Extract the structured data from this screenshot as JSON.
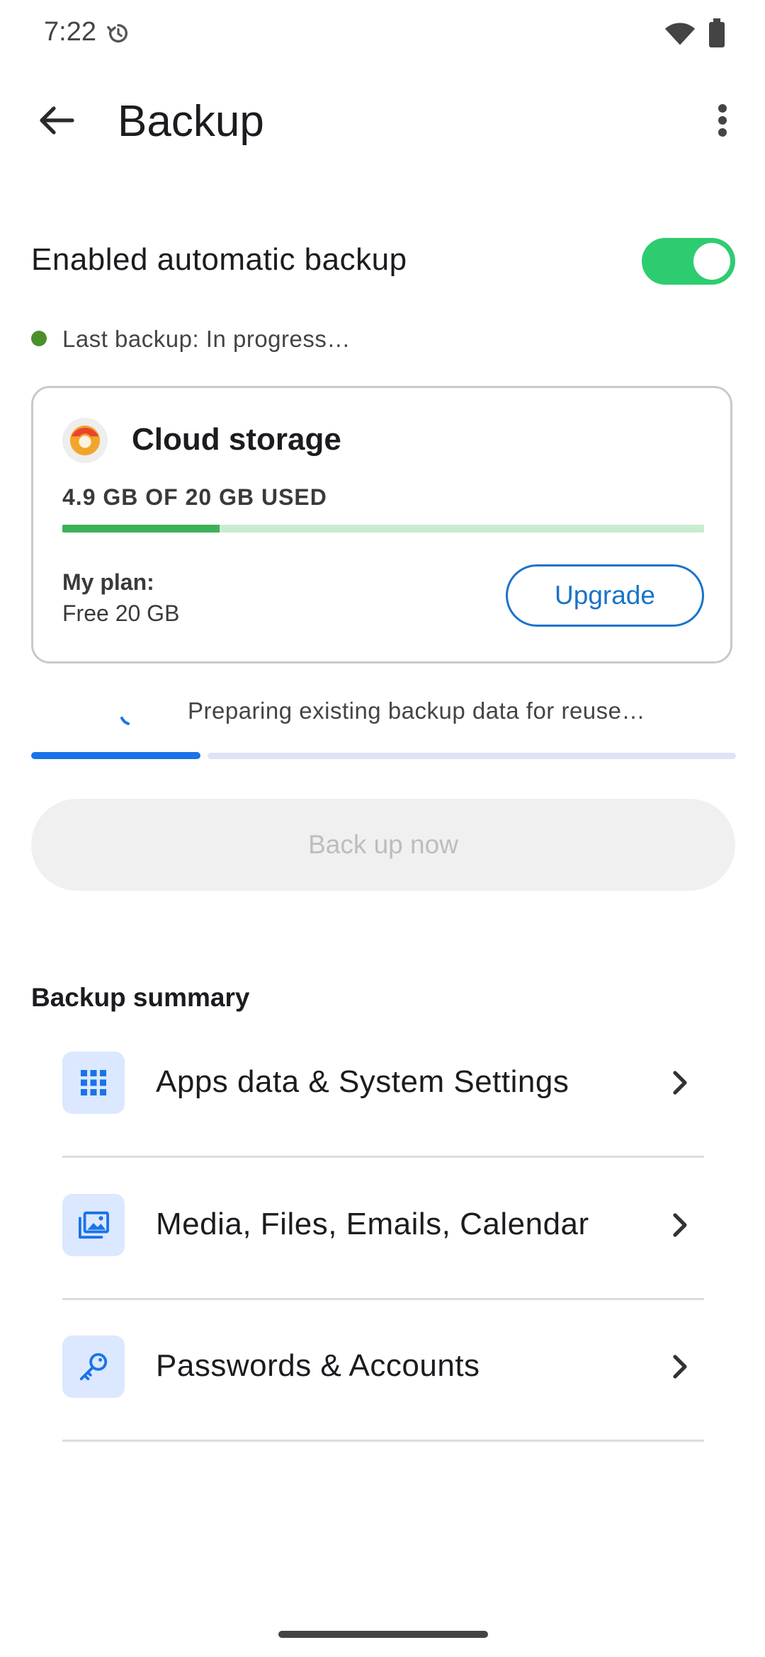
{
  "status_bar": {
    "time": "7:22"
  },
  "app_bar": {
    "title": "Backup"
  },
  "auto_backup": {
    "label": "Enabled automatic backup",
    "enabled": true
  },
  "last_backup": {
    "text": "Last backup: In progress…"
  },
  "cloud_card": {
    "title": "Cloud storage",
    "usage_text": "4.9 GB OF 20 GB USED",
    "used_fraction": 0.245,
    "plan_label": "My plan:",
    "plan_value": "Free 20 GB",
    "upgrade_label": "Upgrade"
  },
  "progress": {
    "text": "Preparing existing backup data for reuse…",
    "fraction": 0.24
  },
  "backup_now": {
    "label": "Back up now",
    "enabled": false
  },
  "summary": {
    "heading": "Backup summary",
    "items": [
      {
        "label": "Apps data & System Settings",
        "icon": "apps-grid-icon"
      },
      {
        "label": "Media, Files, Emails, Calendar",
        "icon": "photo-library-icon"
      },
      {
        "label": "Passwords & Accounts",
        "icon": "key-icon"
      }
    ]
  },
  "colors": {
    "toggle_on": "#2ecc71",
    "accent_blue": "#1a73e8",
    "storage_green": "#3db05a",
    "status_dot": "#4b8f2a"
  }
}
